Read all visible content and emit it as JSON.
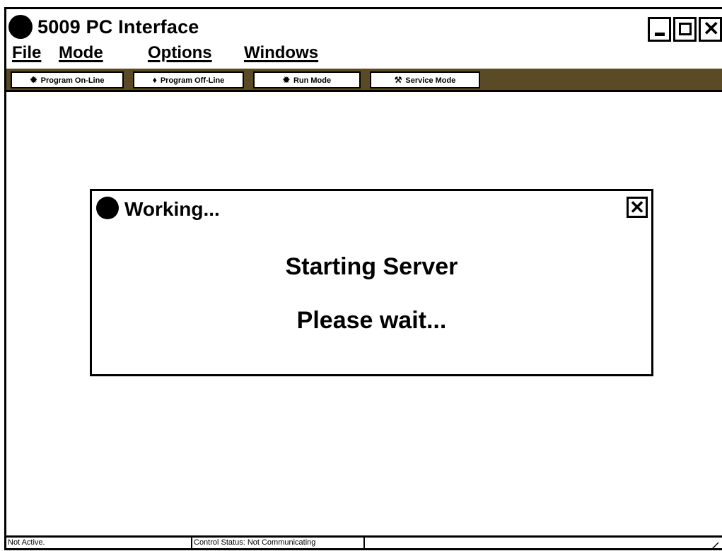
{
  "window": {
    "title": "5009 PC Interface",
    "controls": {
      "minimize": "minimize",
      "maximize": "maximize",
      "close": "close"
    }
  },
  "menu": {
    "items": [
      "File",
      "Mode",
      "Options",
      "Windows"
    ]
  },
  "toolbar": {
    "buttons": [
      {
        "label": "Program On-Line",
        "icon": "gear-icon",
        "glyph": "✹"
      },
      {
        "label": "Program Off-Line",
        "icon": "pin-icon",
        "glyph": "♦"
      },
      {
        "label": "Run Mode",
        "icon": "gear-icon",
        "glyph": "✹"
      },
      {
        "label": "Service Mode",
        "icon": "wrench-icon",
        "glyph": "⚒"
      }
    ],
    "bar_color": "#5b4a26"
  },
  "dialog": {
    "title": "Working...",
    "message_line1": "Starting Server",
    "message_line2": "Please wait...",
    "close_glyph": "✕"
  },
  "statusbar": {
    "left": "Not Active.",
    "middle": "Control Status: Not Communicating"
  }
}
